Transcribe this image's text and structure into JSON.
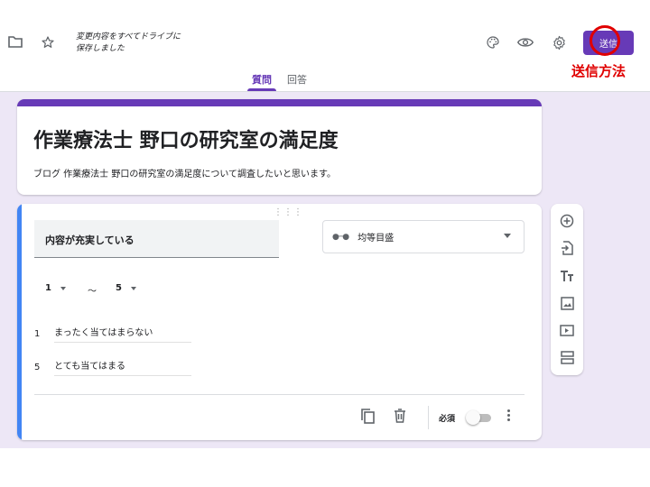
{
  "header": {
    "save_status_line1": "変更内容をすべてドライブに",
    "save_status_line2": "保存しました",
    "send_label": "送信",
    "annotation": "送信方法",
    "tabs": [
      {
        "label": "質問",
        "active": true
      },
      {
        "label": "回答",
        "active": false
      }
    ]
  },
  "form": {
    "title": "作業療法士 野口の研究室の満足度",
    "description": "ブログ 作業療法士 野口の研究室の満足度について調査したいと思います。"
  },
  "question": {
    "title": "内容が充実している",
    "type": "均等目盛",
    "range_min": "1",
    "range_sep": "〜",
    "range_max": "5",
    "labels": [
      {
        "num": "1",
        "text": "まったく当てはまらない"
      },
      {
        "num": "5",
        "text": "とても当てはまる"
      }
    ],
    "required_label": "必須",
    "required": false
  },
  "colors": {
    "accent": "#673ab7",
    "question_accent": "#4285f4",
    "background": "#ede7f6",
    "annotation": "#e00000"
  },
  "icons": {
    "header": [
      "folder-icon",
      "star-icon",
      "palette-icon",
      "eye-icon",
      "gear-icon"
    ],
    "footer": [
      "copy-icon",
      "trash-icon",
      "more-vert-icon"
    ],
    "toolbar": [
      "add-circle-icon",
      "import-icon",
      "text-format-icon",
      "image-icon",
      "video-icon",
      "section-icon"
    ]
  }
}
